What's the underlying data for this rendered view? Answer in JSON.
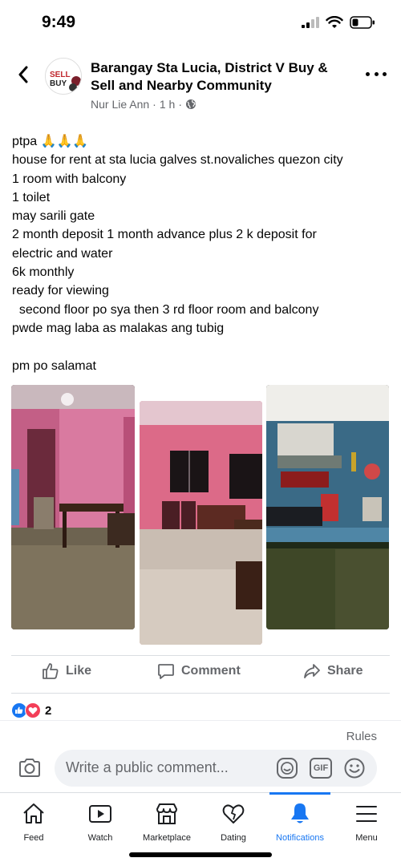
{
  "status_bar": {
    "time": "9:49"
  },
  "header": {
    "group_name": "Barangay Sta Lucia, District V Buy & Sell and Nearby Community",
    "author": "Nur Lie Ann",
    "time_ago": "1 h",
    "separator": "·",
    "avatar_text": "SELL BUY"
  },
  "post": {
    "lines": [
      "ptpa 🙏🙏🙏",
      "house for rent at sta lucia galves st.novaliches quezon city",
      "1 room with balcony",
      "1 toilet",
      "may sarili gate",
      "2 month deposit 1 month advance plus 2 k deposit for",
      "electric and water",
      "6k monthly",
      "ready for viewing",
      "  second floor po sya then 3 rd floor room and balcony",
      "pwde mag laba as malakas ang tubig",
      "",
      "pm po salamat"
    ]
  },
  "actions": {
    "like": "Like",
    "comment": "Comment",
    "share": "Share"
  },
  "reactions": {
    "count": "2",
    "types": [
      "like",
      "love"
    ]
  },
  "comments": {
    "rules_label": "Rules",
    "placeholder": "Write a public comment...",
    "gif_label": "GIF"
  },
  "tabbar": {
    "active": "Notifications",
    "tabs": [
      {
        "label": "Feed",
        "icon": "home-icon"
      },
      {
        "label": "Watch",
        "icon": "play-icon"
      },
      {
        "label": "Marketplace",
        "icon": "shop-icon"
      },
      {
        "label": "Dating",
        "icon": "heart-icon"
      },
      {
        "label": "Notifications",
        "icon": "bell-icon"
      },
      {
        "label": "Menu",
        "icon": "menu-icon"
      }
    ]
  },
  "colors": {
    "accent": "#1877f2",
    "secondary_text": "#65676b",
    "love": "#f33e58"
  }
}
